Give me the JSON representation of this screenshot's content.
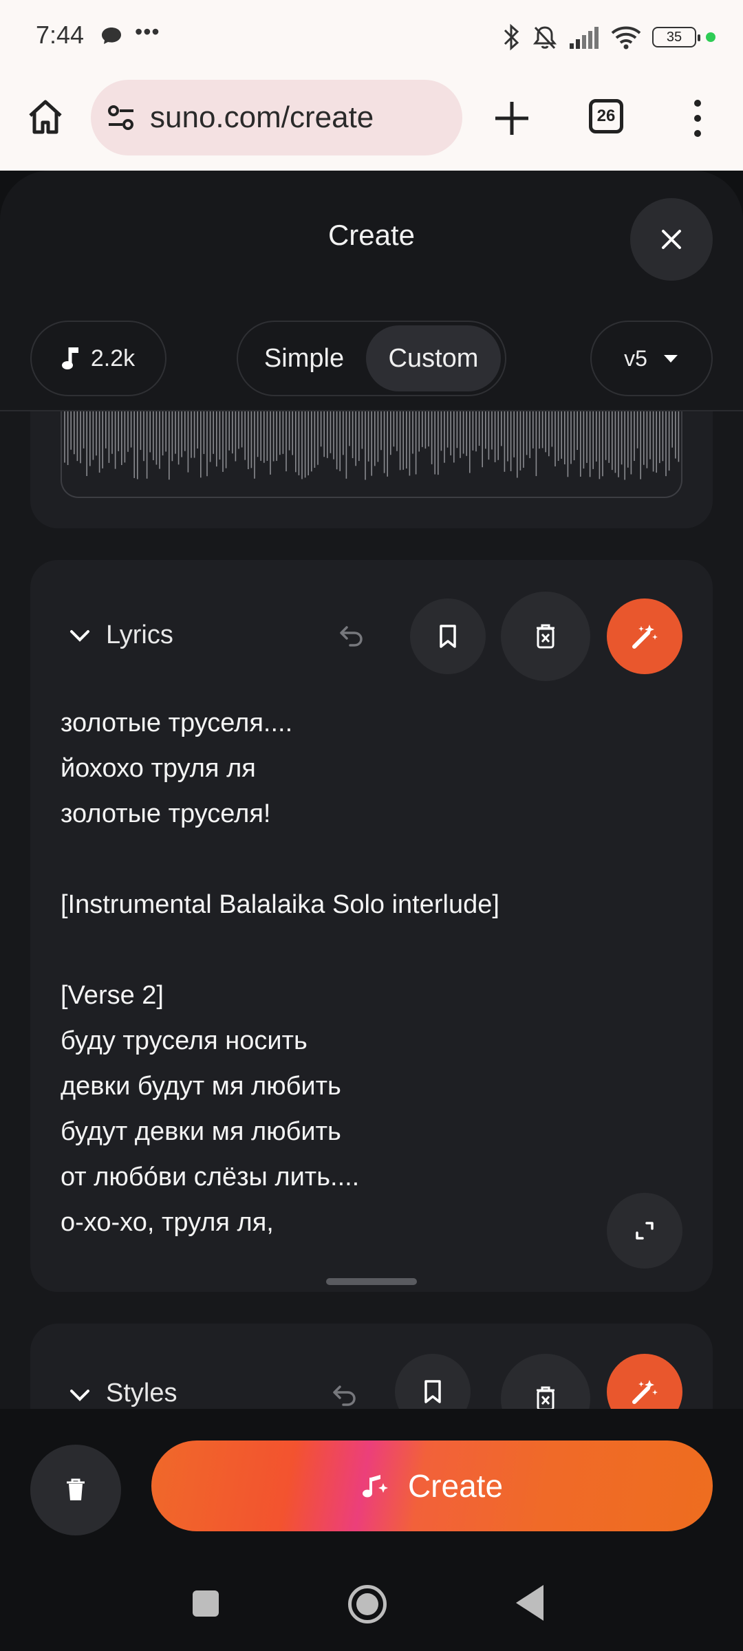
{
  "status": {
    "time": "7:44",
    "battery": "35",
    "icons": [
      "chat-icon",
      "more-dots-icon",
      "bluetooth-icon",
      "mute-icon",
      "signal-icon",
      "wifi-icon",
      "battery-icon"
    ]
  },
  "browser": {
    "url": "suno.com/create",
    "tab_count": "26"
  },
  "sheet": {
    "title": "Create",
    "credits": "2.2k",
    "modes": [
      "Simple",
      "Custom"
    ],
    "active_mode": "Custom",
    "version": "v5"
  },
  "lyrics": {
    "label": "Lyrics",
    "text": "золотые труселя....\nйохохо труля ля\nзолотые труселя!\n\n[Instrumental Balalaika Solo interlude]\n\n[Verse 2]\nбуду труселя носить\nдевки будут мя любить\nбудут девки мя любить\nот любо́ви слёзы лить....\nо-хо-хо, труля ля,"
  },
  "styles": {
    "label": "Styles"
  },
  "bottom": {
    "create_label": "Create"
  },
  "colors": {
    "accent": "#e9572d",
    "sheet_bg": "#17181b",
    "card_bg": "#1e1f23"
  }
}
